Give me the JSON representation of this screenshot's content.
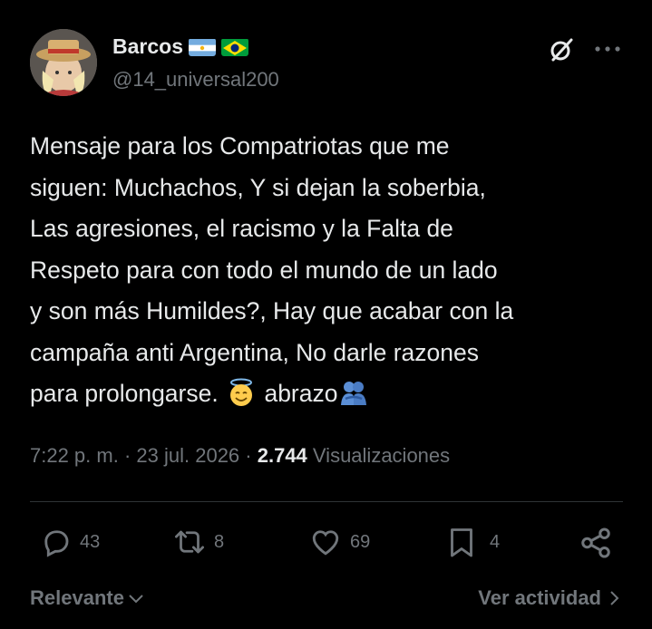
{
  "author": {
    "name": "Barcos",
    "handle": "@14_universal200",
    "flags": [
      "argentina-flag",
      "brazil-flag"
    ]
  },
  "tweet": {
    "line1": "Mensaje para los Compatriotas que me",
    "line2": "siguen: Muchachos, Y si dejan la soberbia,",
    "line3": "Las agresiones, el racismo y la Falta de",
    "line4": "Respeto para con todo el mundo de un lado",
    "line5": "y son más Humildes?, Hay que acabar con la",
    "line6": "campaña anti Argentina, No darle razones",
    "line7a": "para prolongarse. ",
    "line7b": " abrazo",
    "emoji1": "smiling-face-with-halo",
    "emoji2": "people-hugging"
  },
  "meta": {
    "time": "7:22 p. m.",
    "sep1": " · ",
    "date": "23 jul. 2026",
    "sep2": " · ",
    "views_count": "2.744",
    "views_label": " Visualizaciones"
  },
  "actions": {
    "replies": "43",
    "reposts": "8",
    "likes": "69",
    "bookmarks": "4"
  },
  "footer": {
    "sort_label": "Relevante",
    "activity_label": "Ver actividad"
  },
  "colors": {
    "background": "#000000",
    "text": "#e7e9ea",
    "muted": "#71767b",
    "divider": "#2f3336"
  }
}
